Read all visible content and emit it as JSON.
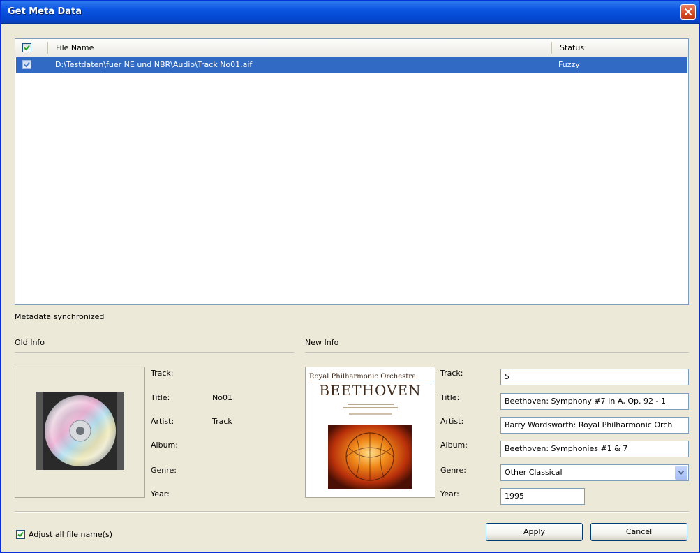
{
  "window": {
    "title": "Get Meta Data"
  },
  "list": {
    "columns": {
      "file_name": "File Name",
      "status": "Status"
    },
    "rows": [
      {
        "file_name": "D:\\Testdaten\\fuer NE und NBR\\Audio\\Track No01.aif",
        "status": "Fuzzy",
        "checked": true
      }
    ]
  },
  "status_message": "Metadata synchronized",
  "old_info": {
    "heading": "Old Info",
    "labels": {
      "track": "Track:",
      "title": "Title:",
      "artist": "Artist:",
      "album": "Album:",
      "genre": "Genre:",
      "year": "Year:"
    },
    "values": {
      "track": "",
      "title": "No01",
      "artist": "Track",
      "album": "",
      "genre": "",
      "year": ""
    }
  },
  "new_info": {
    "heading": "New Info",
    "album_art": {
      "line1": "Royal Philharmonic Orchestra",
      "line2": "BEETHOVEN"
    },
    "labels": {
      "track": "Track:",
      "title": "Title:",
      "artist": "Artist:",
      "album": "Album:",
      "genre": "Genre:",
      "year": "Year:"
    },
    "values": {
      "track": "5",
      "title": "Beethoven: Symphony #7 In A, Op. 92 - 1",
      "artist": "Barry Wordsworth: Royal Philharmonic Orch",
      "album": "Beethoven: Symphonies #1 & 7",
      "genre": "Other Classical",
      "year": "1995"
    }
  },
  "footer": {
    "adjust_label": "Adjust all file name(s)",
    "adjust_checked": true,
    "apply_label": "Apply",
    "cancel_label": "Cancel"
  },
  "colors": {
    "selection": "#316ac5",
    "titlebar": "#0a55e0",
    "dialog_bg": "#ece9d8",
    "check": "#21a121"
  },
  "icons": {
    "close": "close-icon",
    "check": "check-icon",
    "dropdown": "chevron-down-icon",
    "cd": "cd-icon"
  }
}
